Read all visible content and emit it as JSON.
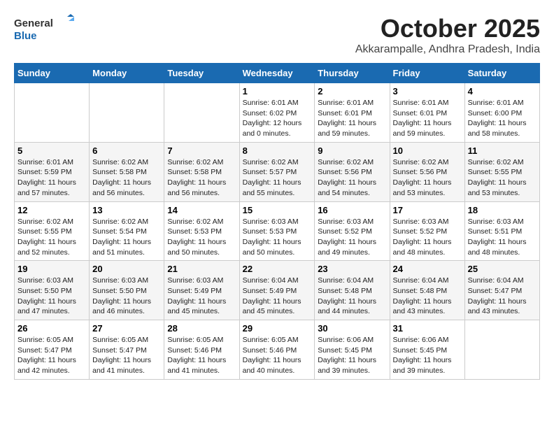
{
  "header": {
    "logo_line1": "General",
    "logo_line2": "Blue",
    "month": "October 2025",
    "location": "Akkarampalle, Andhra Pradesh, India"
  },
  "weekdays": [
    "Sunday",
    "Monday",
    "Tuesday",
    "Wednesday",
    "Thursday",
    "Friday",
    "Saturday"
  ],
  "weeks": [
    [
      {
        "day": "",
        "info": ""
      },
      {
        "day": "",
        "info": ""
      },
      {
        "day": "",
        "info": ""
      },
      {
        "day": "1",
        "info": "Sunrise: 6:01 AM\nSunset: 6:02 PM\nDaylight: 12 hours\nand 0 minutes."
      },
      {
        "day": "2",
        "info": "Sunrise: 6:01 AM\nSunset: 6:01 PM\nDaylight: 11 hours\nand 59 minutes."
      },
      {
        "day": "3",
        "info": "Sunrise: 6:01 AM\nSunset: 6:01 PM\nDaylight: 11 hours\nand 59 minutes."
      },
      {
        "day": "4",
        "info": "Sunrise: 6:01 AM\nSunset: 6:00 PM\nDaylight: 11 hours\nand 58 minutes."
      }
    ],
    [
      {
        "day": "5",
        "info": "Sunrise: 6:01 AM\nSunset: 5:59 PM\nDaylight: 11 hours\nand 57 minutes."
      },
      {
        "day": "6",
        "info": "Sunrise: 6:02 AM\nSunset: 5:58 PM\nDaylight: 11 hours\nand 56 minutes."
      },
      {
        "day": "7",
        "info": "Sunrise: 6:02 AM\nSunset: 5:58 PM\nDaylight: 11 hours\nand 56 minutes."
      },
      {
        "day": "8",
        "info": "Sunrise: 6:02 AM\nSunset: 5:57 PM\nDaylight: 11 hours\nand 55 minutes."
      },
      {
        "day": "9",
        "info": "Sunrise: 6:02 AM\nSunset: 5:56 PM\nDaylight: 11 hours\nand 54 minutes."
      },
      {
        "day": "10",
        "info": "Sunrise: 6:02 AM\nSunset: 5:56 PM\nDaylight: 11 hours\nand 53 minutes."
      },
      {
        "day": "11",
        "info": "Sunrise: 6:02 AM\nSunset: 5:55 PM\nDaylight: 11 hours\nand 53 minutes."
      }
    ],
    [
      {
        "day": "12",
        "info": "Sunrise: 6:02 AM\nSunset: 5:55 PM\nDaylight: 11 hours\nand 52 minutes."
      },
      {
        "day": "13",
        "info": "Sunrise: 6:02 AM\nSunset: 5:54 PM\nDaylight: 11 hours\nand 51 minutes."
      },
      {
        "day": "14",
        "info": "Sunrise: 6:02 AM\nSunset: 5:53 PM\nDaylight: 11 hours\nand 50 minutes."
      },
      {
        "day": "15",
        "info": "Sunrise: 6:03 AM\nSunset: 5:53 PM\nDaylight: 11 hours\nand 50 minutes."
      },
      {
        "day": "16",
        "info": "Sunrise: 6:03 AM\nSunset: 5:52 PM\nDaylight: 11 hours\nand 49 minutes."
      },
      {
        "day": "17",
        "info": "Sunrise: 6:03 AM\nSunset: 5:52 PM\nDaylight: 11 hours\nand 48 minutes."
      },
      {
        "day": "18",
        "info": "Sunrise: 6:03 AM\nSunset: 5:51 PM\nDaylight: 11 hours\nand 48 minutes."
      }
    ],
    [
      {
        "day": "19",
        "info": "Sunrise: 6:03 AM\nSunset: 5:50 PM\nDaylight: 11 hours\nand 47 minutes."
      },
      {
        "day": "20",
        "info": "Sunrise: 6:03 AM\nSunset: 5:50 PM\nDaylight: 11 hours\nand 46 minutes."
      },
      {
        "day": "21",
        "info": "Sunrise: 6:03 AM\nSunset: 5:49 PM\nDaylight: 11 hours\nand 45 minutes."
      },
      {
        "day": "22",
        "info": "Sunrise: 6:04 AM\nSunset: 5:49 PM\nDaylight: 11 hours\nand 45 minutes."
      },
      {
        "day": "23",
        "info": "Sunrise: 6:04 AM\nSunset: 5:48 PM\nDaylight: 11 hours\nand 44 minutes."
      },
      {
        "day": "24",
        "info": "Sunrise: 6:04 AM\nSunset: 5:48 PM\nDaylight: 11 hours\nand 43 minutes."
      },
      {
        "day": "25",
        "info": "Sunrise: 6:04 AM\nSunset: 5:47 PM\nDaylight: 11 hours\nand 43 minutes."
      }
    ],
    [
      {
        "day": "26",
        "info": "Sunrise: 6:05 AM\nSunset: 5:47 PM\nDaylight: 11 hours\nand 42 minutes."
      },
      {
        "day": "27",
        "info": "Sunrise: 6:05 AM\nSunset: 5:47 PM\nDaylight: 11 hours\nand 41 minutes."
      },
      {
        "day": "28",
        "info": "Sunrise: 6:05 AM\nSunset: 5:46 PM\nDaylight: 11 hours\nand 41 minutes."
      },
      {
        "day": "29",
        "info": "Sunrise: 6:05 AM\nSunset: 5:46 PM\nDaylight: 11 hours\nand 40 minutes."
      },
      {
        "day": "30",
        "info": "Sunrise: 6:06 AM\nSunset: 5:45 PM\nDaylight: 11 hours\nand 39 minutes."
      },
      {
        "day": "31",
        "info": "Sunrise: 6:06 AM\nSunset: 5:45 PM\nDaylight: 11 hours\nand 39 minutes."
      },
      {
        "day": "",
        "info": ""
      }
    ]
  ]
}
